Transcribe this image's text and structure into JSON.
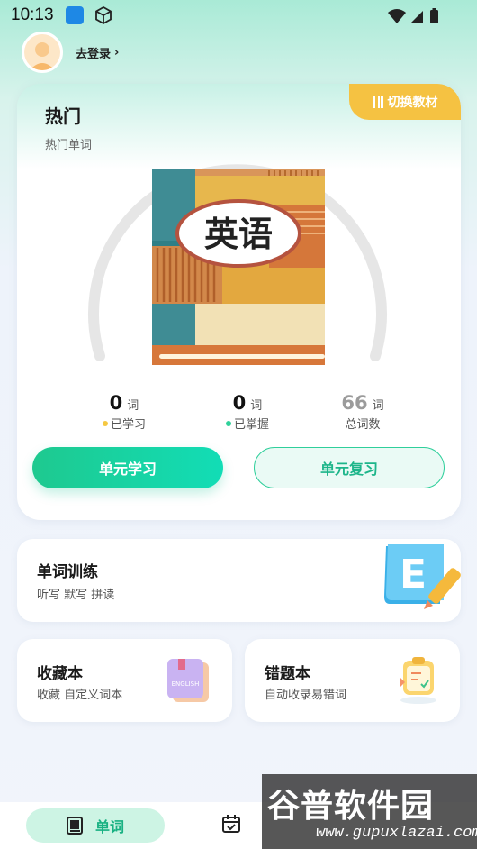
{
  "status_bar": {
    "time": "10:13"
  },
  "profile": {
    "login_label": "去登录",
    "chevron": "›"
  },
  "main_card": {
    "title": "热门",
    "subtitle": "热门单词",
    "switch_label": "切换教材",
    "book_title": "英语",
    "stats": [
      {
        "value": "0",
        "unit": "词",
        "label": "已学习",
        "dot_color": "#f5c842"
      },
      {
        "value": "0",
        "unit": "词",
        "label": "已掌握",
        "dot_color": "#2fd19a"
      },
      {
        "value": "66",
        "unit": "词",
        "label": "总词数"
      }
    ],
    "learn_button": "单元学习",
    "review_button": "单元复习"
  },
  "train_card": {
    "title": "单词训练",
    "subtitle": "听写 默写 拼读"
  },
  "favorites_card": {
    "title": "收藏本",
    "subtitle": "收藏 自定义词本",
    "book_text": "ENGLISH"
  },
  "mistakes_card": {
    "title": "错题本",
    "subtitle": "自动收录易错词"
  },
  "bottom_nav": {
    "active_label": "单词"
  },
  "watermark": {
    "main": "谷普软件园",
    "url": "www.gupuxlazai.com"
  },
  "colors": {
    "accent": "#1ec98f",
    "badge": "#f5c242"
  }
}
